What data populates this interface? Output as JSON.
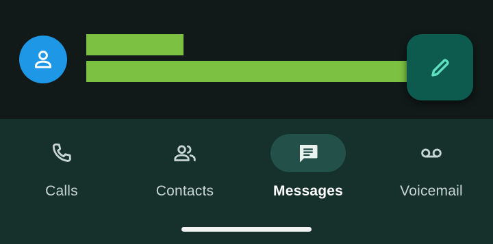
{
  "conversation": {
    "avatar_icon": "person-icon",
    "name": "",
    "snippet": ""
  },
  "fab": {
    "icon": "pencil-icon"
  },
  "nav": {
    "items": [
      {
        "label": "Calls",
        "icon": "phone-icon",
        "active": false
      },
      {
        "label": "Contacts",
        "icon": "people-icon",
        "active": false
      },
      {
        "label": "Messages",
        "icon": "message-icon",
        "active": true
      },
      {
        "label": "Voicemail",
        "icon": "voicemail-icon",
        "active": false
      }
    ]
  },
  "colors": {
    "background": "#111a19",
    "nav_background": "#16302b",
    "active_pill": "#23514a",
    "avatar": "#1e97e6",
    "fab": "#0d5a4e",
    "fab_icon": "#5fe0c0",
    "redaction": "#7cc142"
  }
}
